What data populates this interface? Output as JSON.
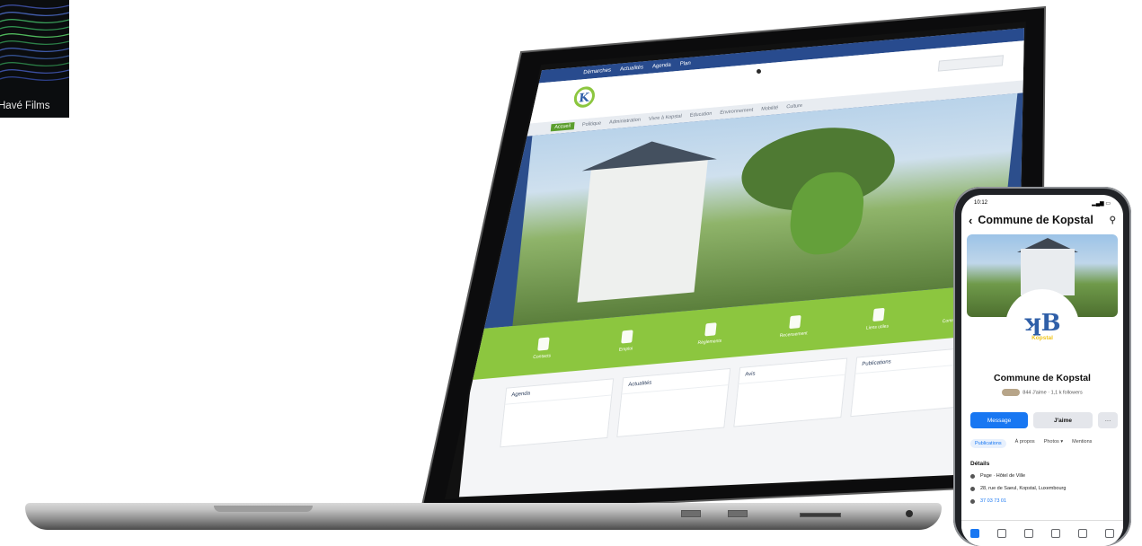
{
  "corner_brand": {
    "text": "Havé Films"
  },
  "laptop": {
    "topnav": [
      "Démarches",
      "Actualités",
      "Agenda",
      "Plan"
    ],
    "mainnav": [
      "Accueil",
      "Politique",
      "Administration",
      "Vivre à Kopstal",
      "Education",
      "Environnement",
      "Mobilité",
      "Culture"
    ],
    "quicklinks": [
      {
        "label": "Contacts"
      },
      {
        "label": "Emploi"
      },
      {
        "label": "Règlements"
      },
      {
        "label": "Recensement"
      },
      {
        "label": "Liens utiles"
      },
      {
        "label": "Commune en ligne"
      }
    ],
    "cards": [
      {
        "title": "Agenda"
      },
      {
        "title": "Actualités"
      },
      {
        "title": "Avis"
      },
      {
        "title": "Publications"
      }
    ]
  },
  "phone": {
    "status_time": "10:12",
    "page_title": "Commune de Kopstal",
    "avatar_text": "Kopstal",
    "page_name": "Commune de Kopstal",
    "stats": "844 J'aime · 1,1 k followers",
    "buttons": {
      "message": "Message",
      "like": "J'aime",
      "more": "···"
    },
    "tabs": [
      "Publications",
      "À propos",
      "Photos ▾",
      "Mentions"
    ],
    "details_title": "Détails",
    "details": [
      {
        "text": "Page · Hôtel de Ville"
      },
      {
        "text": "28, rue de Saeul, Kopstal, Luxembourg"
      },
      {
        "text": "37 03 73 01"
      }
    ]
  }
}
